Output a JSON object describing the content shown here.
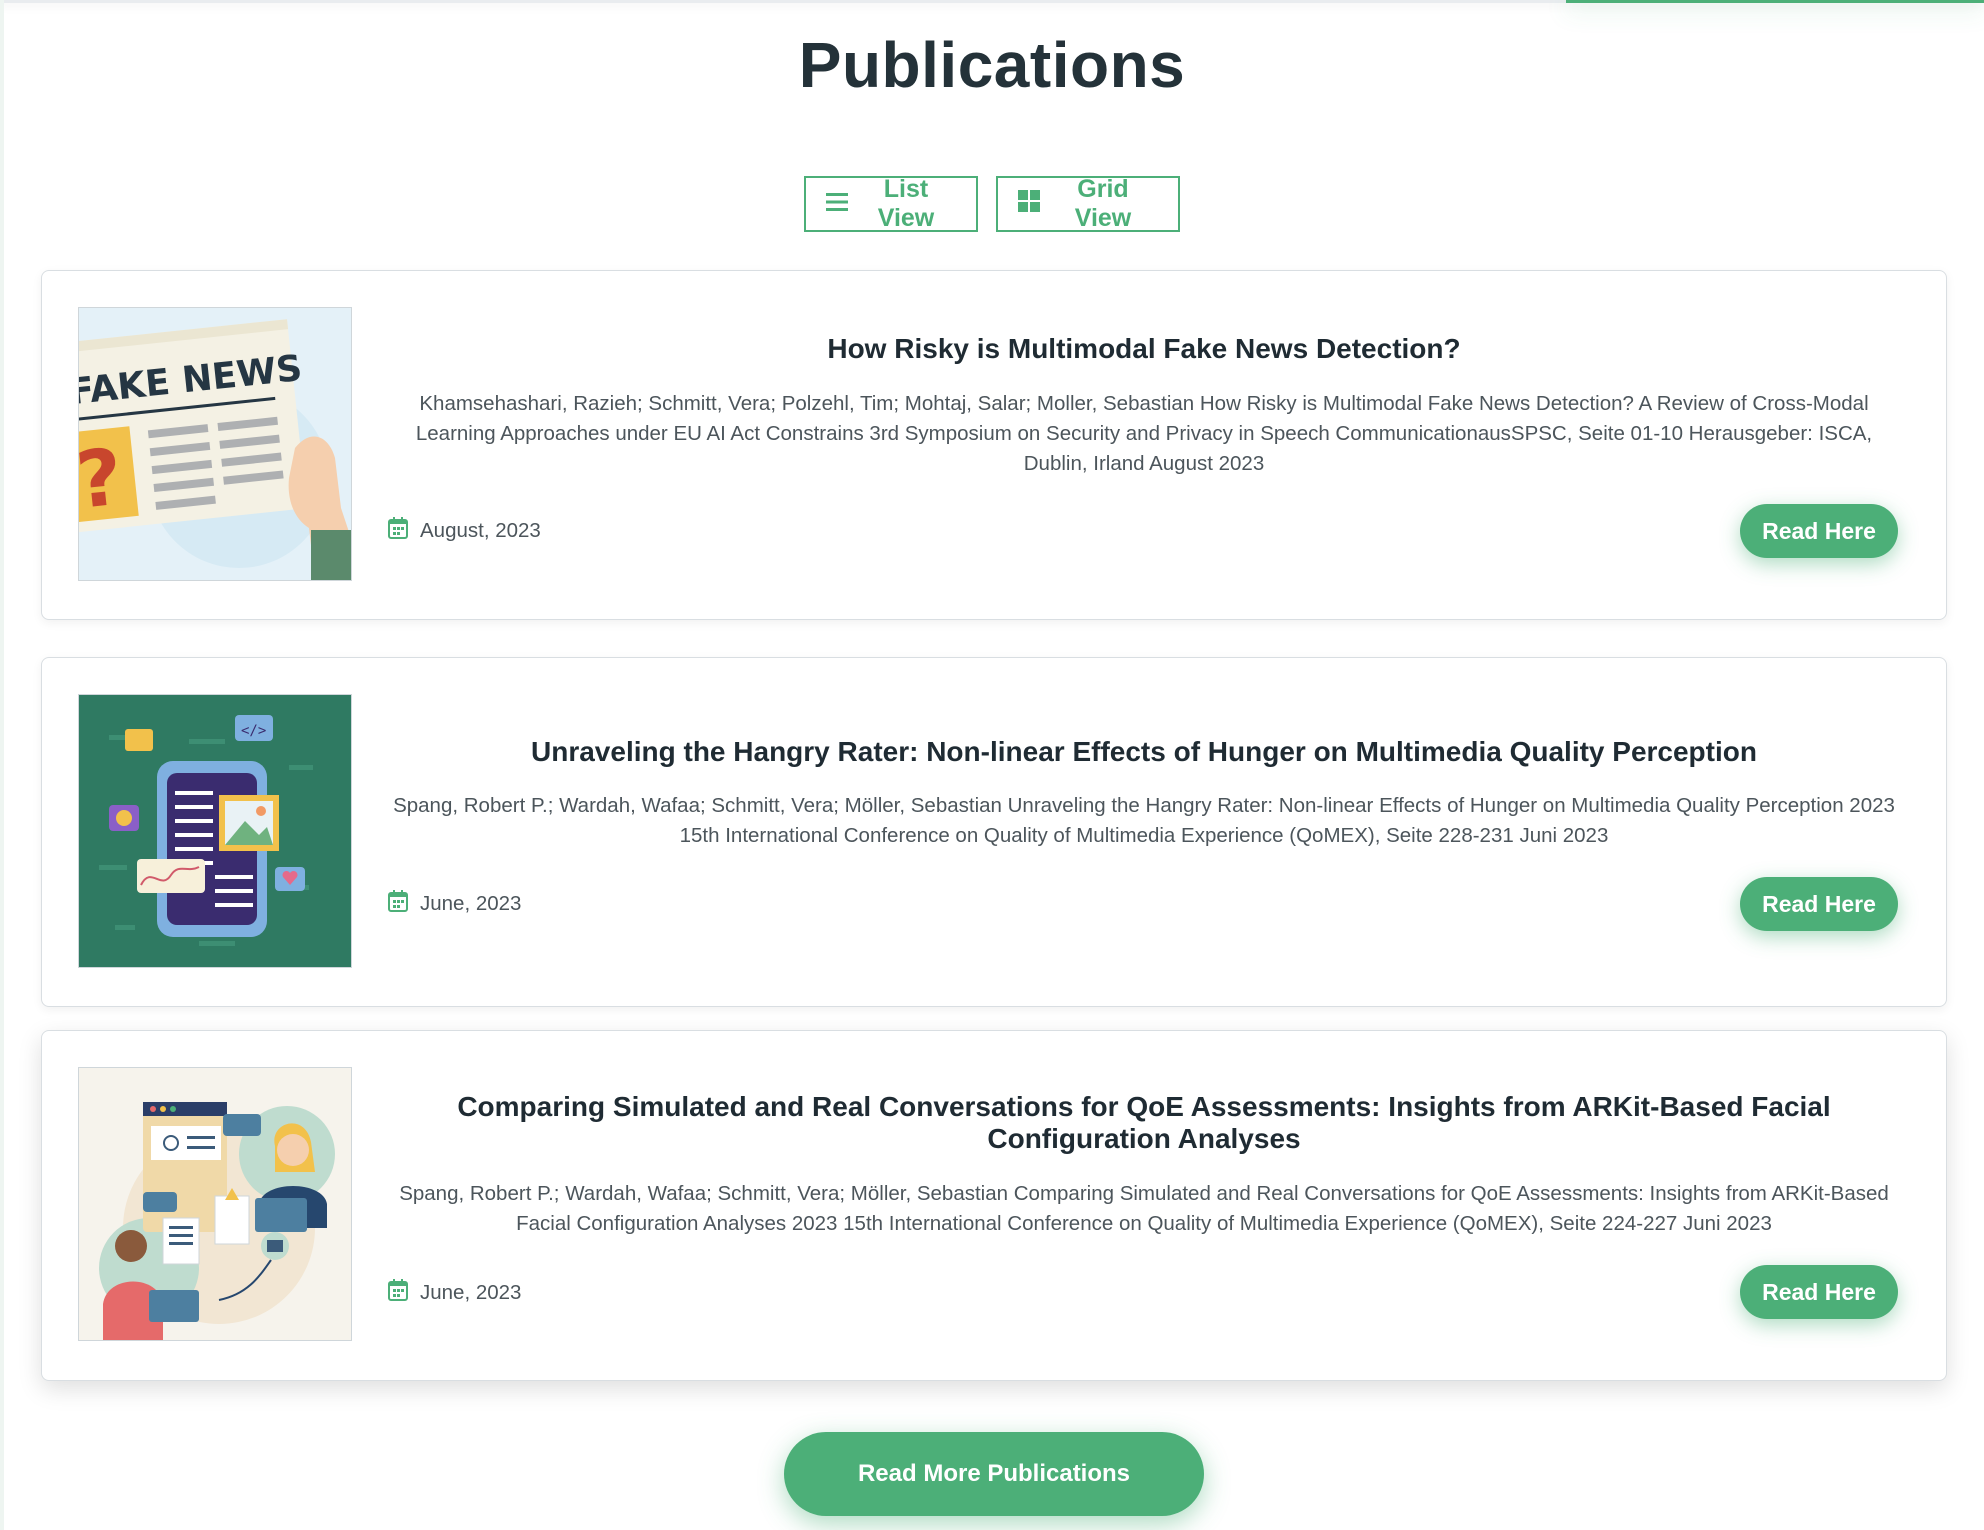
{
  "page": {
    "title": "Publications"
  },
  "view_toggle": {
    "list_label": "List View",
    "grid_label": "Grid View",
    "list_icon": "list-icon",
    "grid_icon": "grid-icon"
  },
  "publications": [
    {
      "title": "How Risky is Multimodal Fake News Detection?",
      "description": "Khamsehashari, Razieh; Schmitt, Vera; Polzehl, Tim; Mohtaj, Salar; Moller, Sebastian How Risky is Multimodal Fake News Detection? A Review of Cross-Modal Learning Approaches under EU AI Act Constrains 3rd Symposium on Security and Privacy in Speech CommunicationausSPSC, Seite 01-10 Herausgeber: ISCA, Dublin, Irland August 2023",
      "date": "August, 2023",
      "button_label": "Read Here",
      "thumb_text": "FAKE NEWS",
      "thumb_icon": "fake-news-newspaper-illustration"
    },
    {
      "title": "Unraveling the Hangry Rater: Non-linear Effects of Hunger on Multimedia Quality Perception",
      "description": "Spang, Robert P.; Wardah, Wafaa; Schmitt, Vera; Möller, Sebastian Unraveling the Hangry Rater: Non-linear Effects of Hunger on Multimedia Quality Perception 2023 15th International Conference on Quality of Multimedia Experience (QoMEX), Seite 228-231 Juni 2023",
      "date": "June, 2023",
      "button_label": "Read Here",
      "thumb_icon": "multimedia-phone-illustration"
    },
    {
      "title": "Comparing Simulated and Real Conversations for QoE Assessments: Insights from ARKit-Based Facial Configuration Analyses",
      "description": "Spang, Robert P.; Wardah, Wafaa; Schmitt, Vera; Möller, Sebastian Comparing Simulated and Real Conversations for QoE Assessments: Insights from ARKit-Based Facial Configuration Analyses 2023 15th International Conference on Quality of Multimedia Experience (QoMEX), Seite 224-227 Juni 2023",
      "date": "June, 2023",
      "button_label": "Read Here",
      "thumb_icon": "conversation-people-illustration"
    }
  ],
  "footer": {
    "more_label": "Read More Publications"
  },
  "colors": {
    "accent": "#4caf78",
    "title_text": "#243239",
    "body_text": "#4c555b"
  }
}
